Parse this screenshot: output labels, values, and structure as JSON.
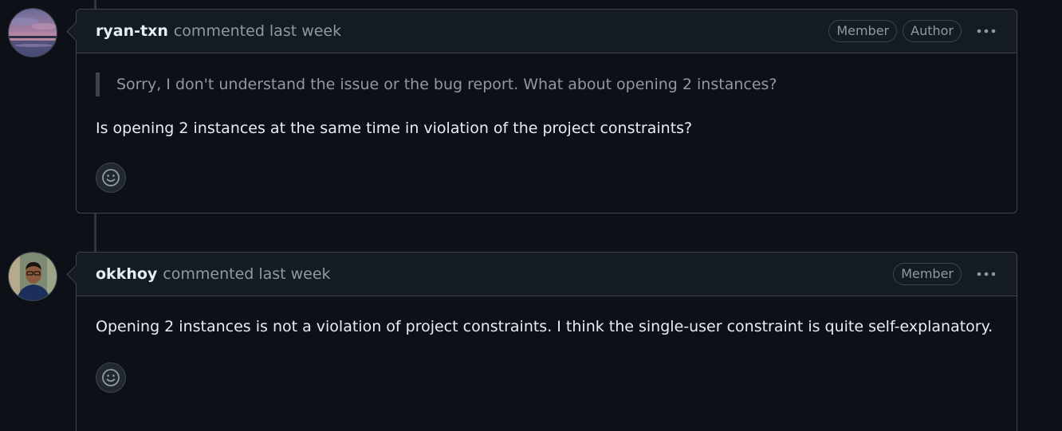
{
  "comments": [
    {
      "author": "ryan-txn",
      "action": "commented",
      "time": "last week",
      "badges": [
        "Member",
        "Author"
      ],
      "quote": "Sorry, I don't understand the issue or the bug report. What about opening 2 instances?",
      "body": "Is opening 2 instances at the same time in violation of the project constraints?",
      "avatar_icon": "sunset-landscape-avatar",
      "reaction_icon": "smiley-icon",
      "menu_icon": "kebab-horizontal-icon"
    },
    {
      "author": "okkhoy",
      "action": "commented",
      "time": "last week",
      "badges": [
        "Member"
      ],
      "body": "Opening 2 instances is not a violation of project constraints. I think the single-user constraint is quite self-explanatory.",
      "avatar_icon": "person-photo-avatar",
      "reaction_icon": "smiley-icon",
      "menu_icon": "kebab-horizontal-icon"
    }
  ],
  "colors": {
    "background": "#0d1117",
    "header_background": "#151b23",
    "border": "#3d444d",
    "text": "#e6edf3",
    "muted_text": "#9198a1"
  }
}
